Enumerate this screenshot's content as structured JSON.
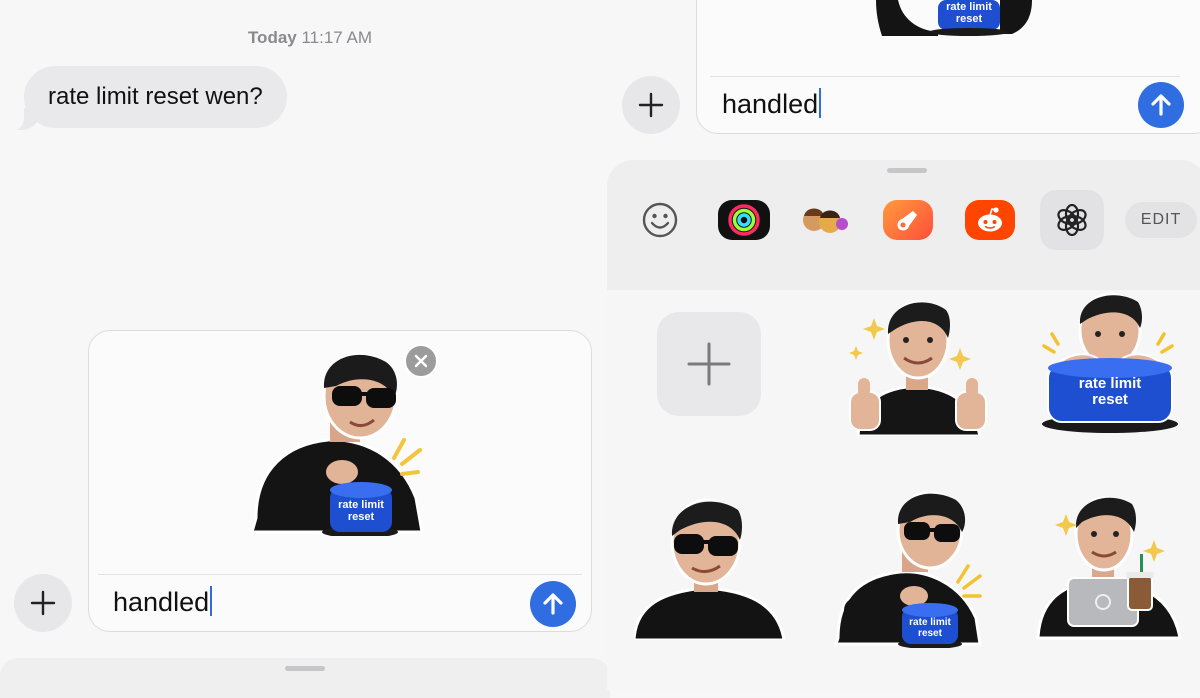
{
  "left": {
    "timestamp": {
      "day": "Today",
      "time": "11:17 AM"
    },
    "incoming_message": "rate limit reset wen?",
    "compose": {
      "text": "handled",
      "attached_sticker": {
        "badge_line1": "rate limit",
        "badge_line2": "reset"
      }
    }
  },
  "right": {
    "compose": {
      "text": "handled",
      "sticker_badge_line1": "rate limit",
      "sticker_badge_line2": "reset"
    },
    "app_drawer": {
      "apps": [
        "emoji-icon",
        "fitness-rings-icon",
        "memoji-icon",
        "garageband-icon",
        "reddit-icon",
        "chatgpt-icon"
      ],
      "edit_label": "EDIT"
    },
    "stickers": [
      {
        "name": "sticker-thumbs-up"
      },
      {
        "name": "sticker-rate-limit-button",
        "badge_line1": "rate limit",
        "badge_line2": "reset"
      },
      {
        "name": "sticker-sunglasses"
      },
      {
        "name": "sticker-pressing-button",
        "badge_line1": "rate limit",
        "badge_line2": "reset"
      },
      {
        "name": "sticker-laptop-coffee"
      }
    ]
  },
  "colors": {
    "accent": "#2f6de1",
    "bubble": "#e9e9eb",
    "background": "#f7f7f7"
  }
}
